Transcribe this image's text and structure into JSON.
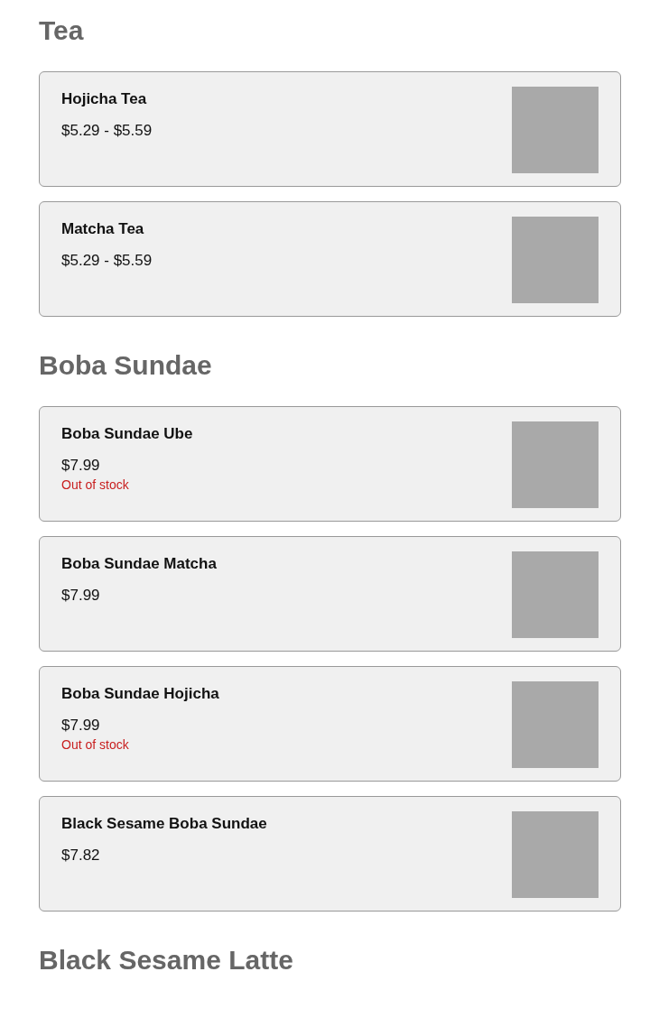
{
  "sections": [
    {
      "title": "Tea",
      "items": [
        {
          "name": "Hojicha Tea",
          "price": "$5.29 - $5.59"
        },
        {
          "name": "Matcha Tea",
          "price": "$5.29 - $5.59"
        }
      ]
    },
    {
      "title": "Boba Sundae",
      "items": [
        {
          "name": "Boba Sundae Ube",
          "price": "$7.99",
          "status": "Out of stock"
        },
        {
          "name": "Boba Sundae Matcha",
          "price": "$7.99"
        },
        {
          "name": "Boba Sundae Hojicha",
          "price": "$7.99",
          "status": "Out of stock"
        },
        {
          "name": "Black Sesame Boba Sundae",
          "price": "$7.82"
        }
      ]
    },
    {
      "title": "Black Sesame Latte"
    }
  ]
}
